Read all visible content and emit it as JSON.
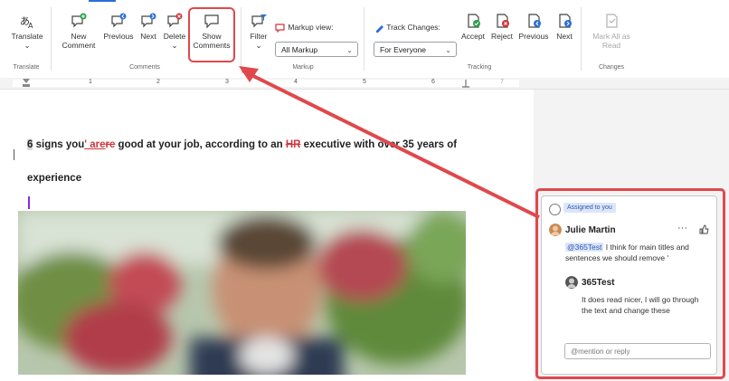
{
  "ribbon": {
    "translate": {
      "label": "Translate",
      "sub": "⌄",
      "group_label": "Translate"
    },
    "comments": {
      "new_comment": "New\nComment",
      "new_line1": "New",
      "new_line2": "Comment",
      "previous": "Previous",
      "next": "Next",
      "delete": "Delete",
      "delete_sub": "⌄",
      "show_line1": "Show",
      "show_line2": "Comments",
      "group_label": "Comments"
    },
    "markup": {
      "filter": "Filter",
      "filter_sub": "⌄",
      "markup_view_label": "Markup view:",
      "markup_view_value": "All Markup",
      "group_label": "Markup"
    },
    "tracking": {
      "track_changes_label": "Track Changes:",
      "track_changes_value": "For Everyone",
      "accept": "Accept",
      "reject": "Reject",
      "previous": "Previous",
      "next": "Next",
      "group_label": "Tracking"
    },
    "changes": {
      "mark_all_line1": "Mark All as",
      "mark_all_line2": "Read",
      "group_label": "Changes"
    },
    "accent": "#e0484c"
  },
  "ruler": {
    "marks": [
      "1",
      "2",
      "3",
      "4",
      "5",
      "6",
      "7"
    ]
  },
  "document": {
    "title_part1": "6",
    "title_part2": " signs you",
    "title_ins": "' are",
    "title_del": "re",
    "title_part3": " good at your job, according to an ",
    "title_del2": "HR",
    "title_part4": " executive with over 35 years of",
    "title_line2": "experience"
  },
  "comment": {
    "assigned": "Assigned to you",
    "author": "Julie Martin",
    "more": "···",
    "like": "👍",
    "mention": "@365Test",
    "text": " I think for main titles and sentences we should remove '",
    "reply_author": "365Test",
    "reply_text": "It does read nicer, I will go through the text and change these",
    "reply_placeholder": "@mention or reply"
  }
}
